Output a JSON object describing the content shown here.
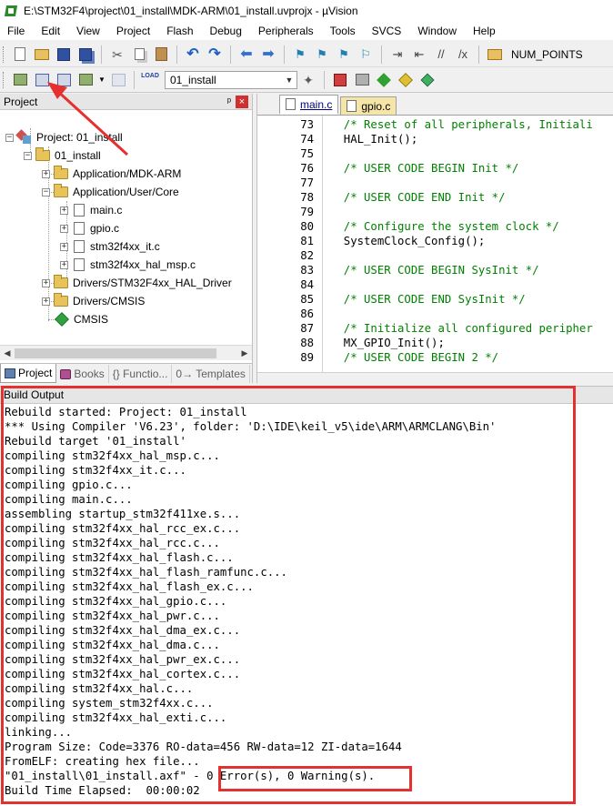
{
  "window": {
    "title": "E:\\STM32F4\\project\\01_install\\MDK-ARM\\01_install.uvprojx - µVision"
  },
  "menu": [
    "File",
    "Edit",
    "View",
    "Project",
    "Flash",
    "Debug",
    "Peripherals",
    "Tools",
    "SVCS",
    "Window",
    "Help"
  ],
  "toolbar1": {
    "find_text": "NUM_POINTS"
  },
  "toolbar2": {
    "load_label": "LOAD",
    "target": "01_install"
  },
  "project_panel": {
    "title": "Project",
    "pin": "ᵖ",
    "close": "×",
    "tree": {
      "root": "Project: 01_install",
      "target": "01_install",
      "groups": {
        "mdk_arm": "Application/MDK-ARM",
        "user_core": "Application/User/Core",
        "files": [
          "main.c",
          "gpio.c",
          "stm32f4xx_it.c",
          "stm32f4xx_hal_msp.c"
        ],
        "hal_driver": "Drivers/STM32F4xx_HAL_Driver",
        "cmsis_drivers": "Drivers/CMSIS",
        "cmsis": "CMSIS"
      }
    },
    "tabs": {
      "project": "Project",
      "books": "Books",
      "functions": "{} Functio...",
      "templates": "0→ Templates"
    }
  },
  "editor": {
    "tabs": [
      "main.c",
      "gpio.c"
    ],
    "lines": [
      {
        "num": "73",
        "text": "  /* Reset of all peripherals, Initiali",
        "comment": true
      },
      {
        "num": "74",
        "text": "  HAL_Init();",
        "comment": false
      },
      {
        "num": "75",
        "text": "",
        "comment": false
      },
      {
        "num": "76",
        "text": "  /* USER CODE BEGIN Init */",
        "comment": true
      },
      {
        "num": "77",
        "text": "",
        "comment": false
      },
      {
        "num": "78",
        "text": "  /* USER CODE END Init */",
        "comment": true
      },
      {
        "num": "79",
        "text": "",
        "comment": false
      },
      {
        "num": "80",
        "text": "  /* Configure the system clock */",
        "comment": true
      },
      {
        "num": "81",
        "text": "  SystemClock_Config();",
        "comment": false
      },
      {
        "num": "82",
        "text": "",
        "comment": false
      },
      {
        "num": "83",
        "text": "  /* USER CODE BEGIN SysInit */",
        "comment": true
      },
      {
        "num": "84",
        "text": "",
        "comment": false
      },
      {
        "num": "85",
        "text": "  /* USER CODE END SysInit */",
        "comment": true
      },
      {
        "num": "86",
        "text": "",
        "comment": false
      },
      {
        "num": "87",
        "text": "  /* Initialize all configured peripher",
        "comment": true
      },
      {
        "num": "88",
        "text": "  MX_GPIO_Init();",
        "comment": false
      },
      {
        "num": "89",
        "text": "  /* USER CODE BEGIN 2 */",
        "comment": true
      }
    ]
  },
  "build_output": {
    "title": "Build Output",
    "lines": [
      "Rebuild started: Project: 01_install",
      "*** Using Compiler 'V6.23', folder: 'D:\\IDE\\keil_v5\\ide\\ARM\\ARMCLANG\\Bin'",
      "Rebuild target '01_install'",
      "compiling stm32f4xx_hal_msp.c...",
      "compiling stm32f4xx_it.c...",
      "compiling gpio.c...",
      "compiling main.c...",
      "assembling startup_stm32f411xe.s...",
      "compiling stm32f4xx_hal_rcc_ex.c...",
      "compiling stm32f4xx_hal_rcc.c...",
      "compiling stm32f4xx_hal_flash.c...",
      "compiling stm32f4xx_hal_flash_ramfunc.c...",
      "compiling stm32f4xx_hal_flash_ex.c...",
      "compiling stm32f4xx_hal_gpio.c...",
      "compiling stm32f4xx_hal_pwr.c...",
      "compiling stm32f4xx_hal_dma_ex.c...",
      "compiling stm32f4xx_hal_dma.c...",
      "compiling stm32f4xx_hal_pwr_ex.c...",
      "compiling stm32f4xx_hal_cortex.c...",
      "compiling stm32f4xx_hal.c...",
      "compiling system_stm32f4xx.c...",
      "compiling stm32f4xx_hal_exti.c...",
      "linking...",
      "Program Size: Code=3376 RO-data=456 RW-data=12 ZI-data=1644",
      "FromELF: creating hex file...",
      "\"01_install\\01_install.axf\" - 0 Error(s), 0 Warning(s).",
      "Build Time Elapsed:  00:00:02"
    ]
  },
  "colors": {
    "annotation": "#e53030",
    "comment": "#008000",
    "folder": "#e8c35a"
  }
}
